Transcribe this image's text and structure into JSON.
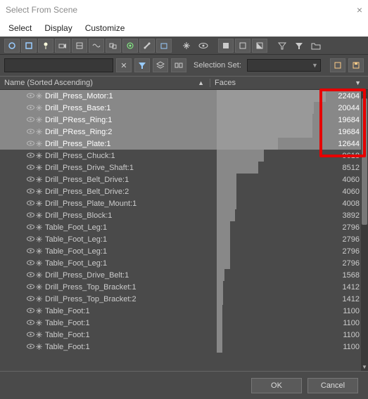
{
  "window": {
    "title": "Select From Scene"
  },
  "menu": {
    "select": "Select",
    "display": "Display",
    "customize": "Customize"
  },
  "toolbar2": {
    "selection_set_label": "Selection Set:"
  },
  "columns": {
    "name": "Name (Sorted Ascending)",
    "faces": "Faces"
  },
  "footer": {
    "ok": "OK",
    "cancel": "Cancel"
  },
  "rows": [
    {
      "name": "Drill_Press_Motor:1",
      "faces": "22404",
      "selected": true,
      "bar": 100
    },
    {
      "name": "Drill_Press_Base:1",
      "faces": "20044",
      "selected": true,
      "bar": 89
    },
    {
      "name": "Drill_PRess_Ring:1",
      "faces": "19684",
      "selected": true,
      "bar": 88
    },
    {
      "name": "Drill_PRess_Ring:2",
      "faces": "19684",
      "selected": true,
      "bar": 88
    },
    {
      "name": "Drill_Press_Plate:1",
      "faces": "12644",
      "selected": true,
      "bar": 56
    },
    {
      "name": "Drill_Press_Chuck:1",
      "faces": "9618",
      "selected": false,
      "bar": 43
    },
    {
      "name": "Drill_Press_Drive_Shaft:1",
      "faces": "8512",
      "selected": false,
      "bar": 38
    },
    {
      "name": "Drill_Press_Belt_Drive:1",
      "faces": "4060",
      "selected": false,
      "bar": 18
    },
    {
      "name": "Drill_Press_Belt_Drive:2",
      "faces": "4060",
      "selected": false,
      "bar": 18
    },
    {
      "name": "Drill_Press_Plate_Mount:1",
      "faces": "4008",
      "selected": false,
      "bar": 18
    },
    {
      "name": "Drill_Press_Block:1",
      "faces": "3892",
      "selected": false,
      "bar": 17
    },
    {
      "name": "Table_Foot_Leg:1",
      "faces": "2796",
      "selected": false,
      "bar": 12
    },
    {
      "name": "Table_Foot_Leg:1",
      "faces": "2796",
      "selected": false,
      "bar": 12
    },
    {
      "name": "Table_Foot_Leg:1",
      "faces": "2796",
      "selected": false,
      "bar": 12
    },
    {
      "name": "Table_Foot_Leg:1",
      "faces": "2796",
      "selected": false,
      "bar": 12
    },
    {
      "name": "Drill_Press_Drive_Belt:1",
      "faces": "1568",
      "selected": false,
      "bar": 7
    },
    {
      "name": "Drill_Press_Top_Bracket:1",
      "faces": "1412",
      "selected": false,
      "bar": 6
    },
    {
      "name": "Drill_Press_Top_Bracket:2",
      "faces": "1412",
      "selected": false,
      "bar": 6
    },
    {
      "name": "Table_Foot:1",
      "faces": "1100",
      "selected": false,
      "bar": 5
    },
    {
      "name": "Table_Foot:1",
      "faces": "1100",
      "selected": false,
      "bar": 5
    },
    {
      "name": "Table_Foot:1",
      "faces": "1100",
      "selected": false,
      "bar": 5
    },
    {
      "name": "Table_Foot:1",
      "faces": "1100",
      "selected": false,
      "bar": 5
    }
  ]
}
